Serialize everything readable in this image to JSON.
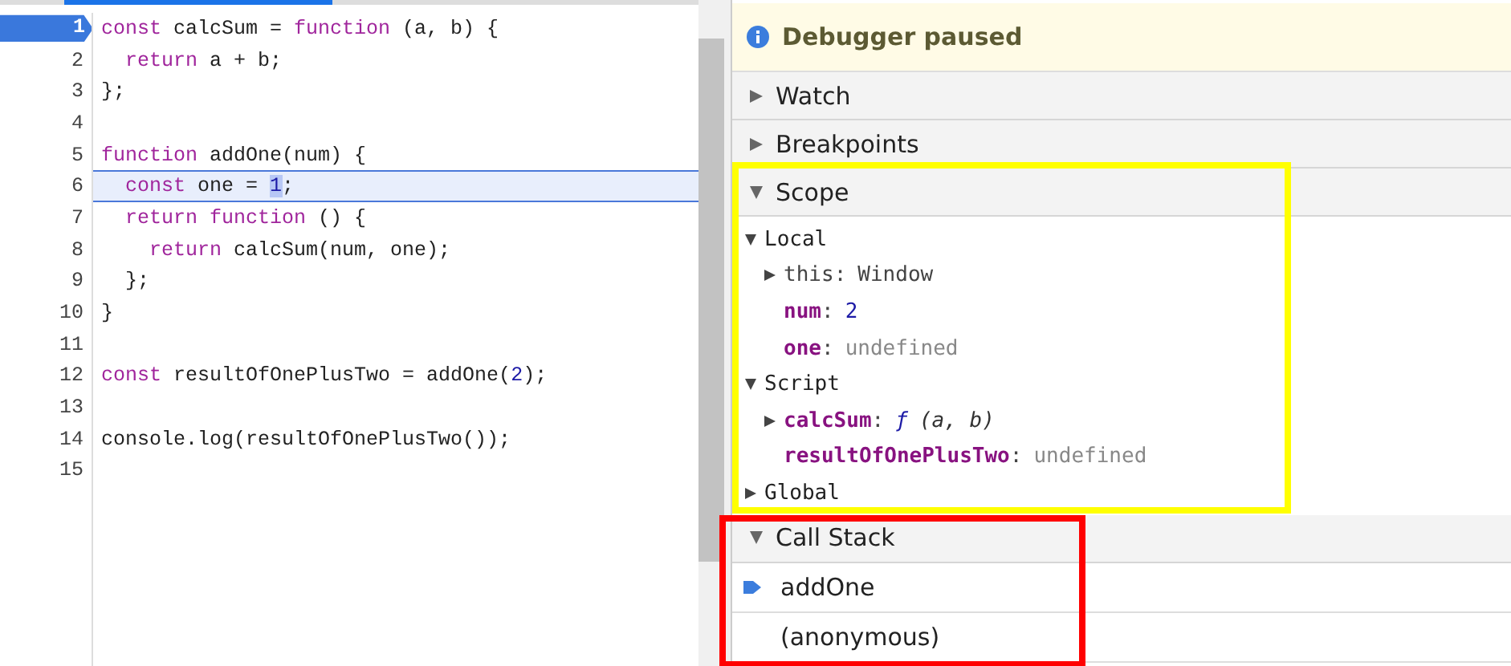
{
  "code": {
    "lines": [
      {
        "number": "1",
        "breakpoint": true,
        "current": false,
        "tokens": [
          {
            "kind": "keyword",
            "text": "const"
          },
          {
            "kind": "plain",
            "text": " calcSum = "
          },
          {
            "kind": "keyword",
            "text": "function"
          },
          {
            "kind": "plain",
            "text": " (a, b) {"
          }
        ]
      },
      {
        "number": "2",
        "breakpoint": false,
        "current": false,
        "tokens": [
          {
            "kind": "keyword",
            "text": "  return"
          },
          {
            "kind": "plain",
            "text": " a + b;"
          }
        ]
      },
      {
        "number": "3",
        "breakpoint": false,
        "current": false,
        "tokens": [
          {
            "kind": "plain",
            "text": "};"
          }
        ]
      },
      {
        "number": "4",
        "breakpoint": false,
        "current": false
      },
      {
        "number": "5",
        "breakpoint": false,
        "current": false,
        "tokens": [
          {
            "kind": "keyword",
            "text": "function"
          },
          {
            "kind": "plain",
            "text": " addOne(num) {"
          }
        ]
      },
      {
        "number": "6",
        "breakpoint": false,
        "current": true,
        "tokens": [
          {
            "kind": "keyword",
            "text": "  const"
          },
          {
            "kind": "plain",
            "text": " one = "
          },
          {
            "kind": "paused-number",
            "text": "1"
          },
          {
            "kind": "plain",
            "text": ";"
          }
        ]
      },
      {
        "number": "7",
        "breakpoint": false,
        "current": false,
        "tokens": [
          {
            "kind": "keyword",
            "text": "  return"
          },
          {
            "kind": "keyword",
            "text": " function"
          },
          {
            "kind": "plain",
            "text": " () {"
          }
        ]
      },
      {
        "number": "8",
        "breakpoint": false,
        "current": false,
        "tokens": [
          {
            "kind": "keyword",
            "text": "    return"
          },
          {
            "kind": "plain",
            "text": " calcSum(num, one);"
          }
        ]
      },
      {
        "number": "9",
        "breakpoint": false,
        "current": false,
        "tokens": [
          {
            "kind": "plain",
            "text": "  };"
          }
        ]
      },
      {
        "number": "10",
        "breakpoint": false,
        "current": false,
        "tokens": [
          {
            "kind": "plain",
            "text": "}"
          }
        ]
      },
      {
        "number": "11",
        "breakpoint": false,
        "current": false
      },
      {
        "number": "12",
        "breakpoint": false,
        "current": false,
        "tokens": [
          {
            "kind": "keyword",
            "text": "const"
          },
          {
            "kind": "plain",
            "text": " resultOfOnePlusTwo = addOne("
          },
          {
            "kind": "number",
            "text": "2"
          },
          {
            "kind": "plain",
            "text": ");"
          }
        ]
      },
      {
        "number": "13",
        "breakpoint": false,
        "current": false
      },
      {
        "number": "14",
        "breakpoint": false,
        "current": false,
        "tokens": [
          {
            "kind": "plain",
            "text": "console.log(resultOfOnePlusTwo());"
          }
        ]
      },
      {
        "number": "15",
        "breakpoint": false,
        "current": false
      }
    ]
  },
  "debugger": {
    "banner": "Debugger paused",
    "sections": [
      {
        "kind": "empty",
        "title": "Watch",
        "expanded": false
      },
      {
        "kind": "empty",
        "title": "Breakpoints",
        "expanded": false
      },
      {
        "kind": "scope",
        "title": "Scope",
        "expanded": true,
        "color": "#ffff00",
        "scopes": [
          {
            "name": "Local",
            "expanded": true,
            "children": [
              {
                "name": "this",
                "kind": "object",
                "separator": ":",
                "value": {
                  "kind": "object",
                  "text": "Window"
                },
                "expanded": false
              },
              {
                "name": "num",
                "kind": "variable",
                "separator": ":",
                "value": {
                  "kind": "number",
                  "text": "2"
                }
              },
              {
                "name": "one",
                "kind": "variable",
                "separator": ":",
                "value": {
                  "kind": "undefined",
                  "text": "undefined"
                }
              }
            ]
          },
          {
            "name": "Script",
            "expanded": true,
            "children": [
              {
                "name": "calcSum",
                "kind": "variable",
                "separator": ":",
                "prefix": "ƒ",
                "value": {
                  "kind": "function",
                  "text": "(a, b)"
                },
                "expanded": false
              },
              {
                "name": "resultOfOnePlusTwo",
                "kind": "variable",
                "separator": ":",
                "value": {
                  "kind": "undefined",
                  "text": "undefined"
                }
              }
            ]
          },
          {
            "name": "Global",
            "expanded": false
          }
        ]
      },
      {
        "kind": "stack",
        "title": "Call Stack",
        "expanded": true,
        "color": "#ff0000",
        "frames": [
          {
            "name": "addOne",
            "selected": true
          },
          {
            "name": "(anonymous)",
            "selected": false
          }
        ]
      }
    ]
  }
}
